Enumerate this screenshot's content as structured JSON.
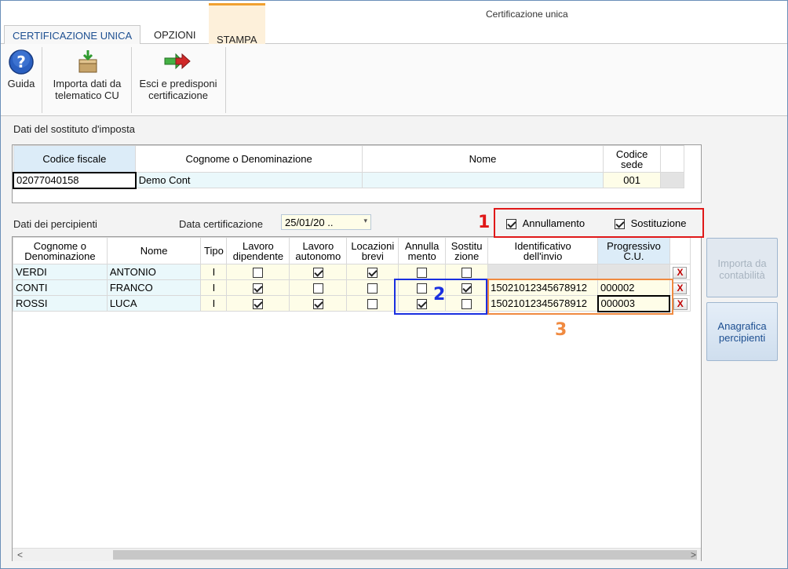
{
  "window": {
    "title": "Certificazione unica"
  },
  "tabs": [
    {
      "label": "CERTIFICAZIONE UNICA"
    },
    {
      "label": "OPZIONI"
    },
    {
      "label": "STAMPA"
    }
  ],
  "ribbon": {
    "guida": "Guida",
    "importa_l1": "Importa dati da",
    "importa_l2": "telematico CU",
    "esci_l1": "Esci e predisponi",
    "esci_l2": "certificazione"
  },
  "sostituto": {
    "section_title": "Dati del sostituto d'imposta",
    "headers": {
      "codice_fiscale": "Codice fiscale",
      "cognome": "Cognome o Denominazione",
      "nome": "Nome",
      "codice_sede_l1": "Codice",
      "codice_sede_l2": "sede"
    },
    "values": {
      "codice_fiscale": "02077040158",
      "cognome": "Demo Cont",
      "nome": "",
      "codice_sede": "001"
    }
  },
  "percipienti": {
    "section_title": "Dati dei percipienti",
    "data_label": "Data certificazione",
    "data_value": "25/01/20 ..",
    "annullamento_label": "Annullamento",
    "annullamento_checked": true,
    "sostituzione_label": "Sostituzione",
    "sostituzione_checked": true,
    "headers": {
      "cognome_l1": "Cognome o",
      "cognome_l2": "Denominazione",
      "nome": "Nome",
      "tipo": "Tipo",
      "lavdip_l1": "Lavoro",
      "lavdip_l2": "dipendente",
      "lavaut_l1": "Lavoro",
      "lavaut_l2": "autonomo",
      "loc_l1": "Locazioni",
      "loc_l2": "brevi",
      "ann_l1": "Annulla",
      "ann_l2": "mento",
      "sost_l1": "Sostitu",
      "sost_l2": "zione",
      "id_l1": "Identificativo",
      "id_l2": "dell'invio",
      "prog_l1": "Progressivo",
      "prog_l2": "C.U."
    },
    "rows": [
      {
        "cognome": "VERDI",
        "nome": "ANTONIO",
        "tipo": "I",
        "lavdip": false,
        "lavaut": true,
        "loc": true,
        "ann": false,
        "sost": false,
        "id": "",
        "prog": ""
      },
      {
        "cognome": "CONTI",
        "nome": "FRANCO",
        "tipo": "I",
        "lavdip": true,
        "lavaut": false,
        "loc": false,
        "ann": false,
        "sost": true,
        "id": "15021012345678912",
        "prog": "000002"
      },
      {
        "cognome": "ROSSI",
        "nome": "LUCA",
        "tipo": "I",
        "lavdip": true,
        "lavaut": true,
        "loc": false,
        "ann": true,
        "sost": false,
        "id": "15021012345678912",
        "prog": "000003"
      }
    ],
    "delete_label": "X"
  },
  "side_buttons": {
    "importa_l1": "Importa da",
    "importa_l2": "contabilità",
    "anagrafica_l1": "Anagrafica",
    "anagrafica_l2": "percipienti"
  },
  "annotations": {
    "n1": "1",
    "n2": "2",
    "n3": "3",
    "color1": "#e01818",
    "color2": "#1a2fe0",
    "color3": "#f08a40"
  },
  "scrollbar": {
    "left": "<",
    "right": ">"
  }
}
